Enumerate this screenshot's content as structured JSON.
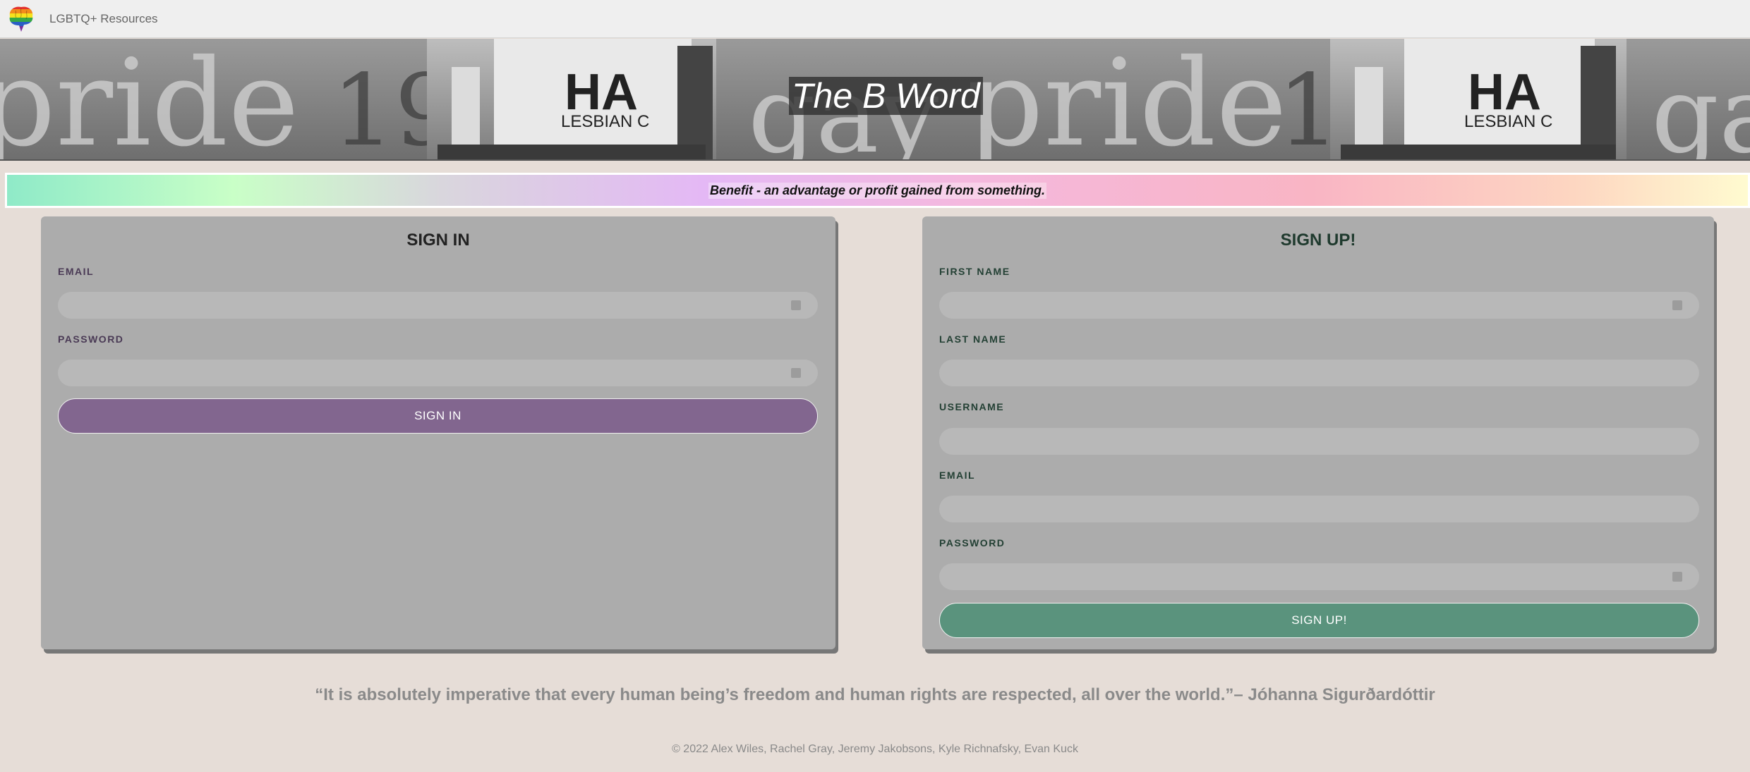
{
  "navbar": {
    "brand": "LGBTQ+ Resources",
    "logo_icon": "rainbow-brain-logo"
  },
  "banner": {
    "title": "The B Word"
  },
  "definition": {
    "text": "Benefit - an advantage or profit gained from something."
  },
  "signin": {
    "title": "SIGN IN",
    "fields": [
      {
        "label": "EMAIL",
        "value": "",
        "placeholder": ""
      },
      {
        "label": "PASSWORD",
        "value": "",
        "placeholder": ""
      }
    ],
    "button_label": "SIGN IN"
  },
  "signup": {
    "title": "SIGN UP!",
    "fields": [
      {
        "label": "FIRST NAME",
        "value": "",
        "placeholder": ""
      },
      {
        "label": "LAST NAME",
        "value": "",
        "placeholder": ""
      },
      {
        "label": "USERNAME",
        "value": "",
        "placeholder": ""
      },
      {
        "label": "EMAIL",
        "value": "",
        "placeholder": ""
      },
      {
        "label": "PASSWORD",
        "value": "",
        "placeholder": ""
      }
    ],
    "button_label": "SIGN UP!"
  },
  "quote": {
    "text": "“It is absolutely imperative that every human being’s freedom and human rights are respected, all over the world.”– Jóhanna Sigurðardóttir"
  },
  "footer": {
    "text": "© 2022 Alex Wiles, Rachel Gray, Jeremy Jakobsons, Kyle Richnafsky, Evan Kuck"
  },
  "colors": {
    "page_bg": "#e6ddd7",
    "card_bg": "#acacac",
    "signin_button": "#82668f",
    "signup_button": "#5a937d"
  }
}
